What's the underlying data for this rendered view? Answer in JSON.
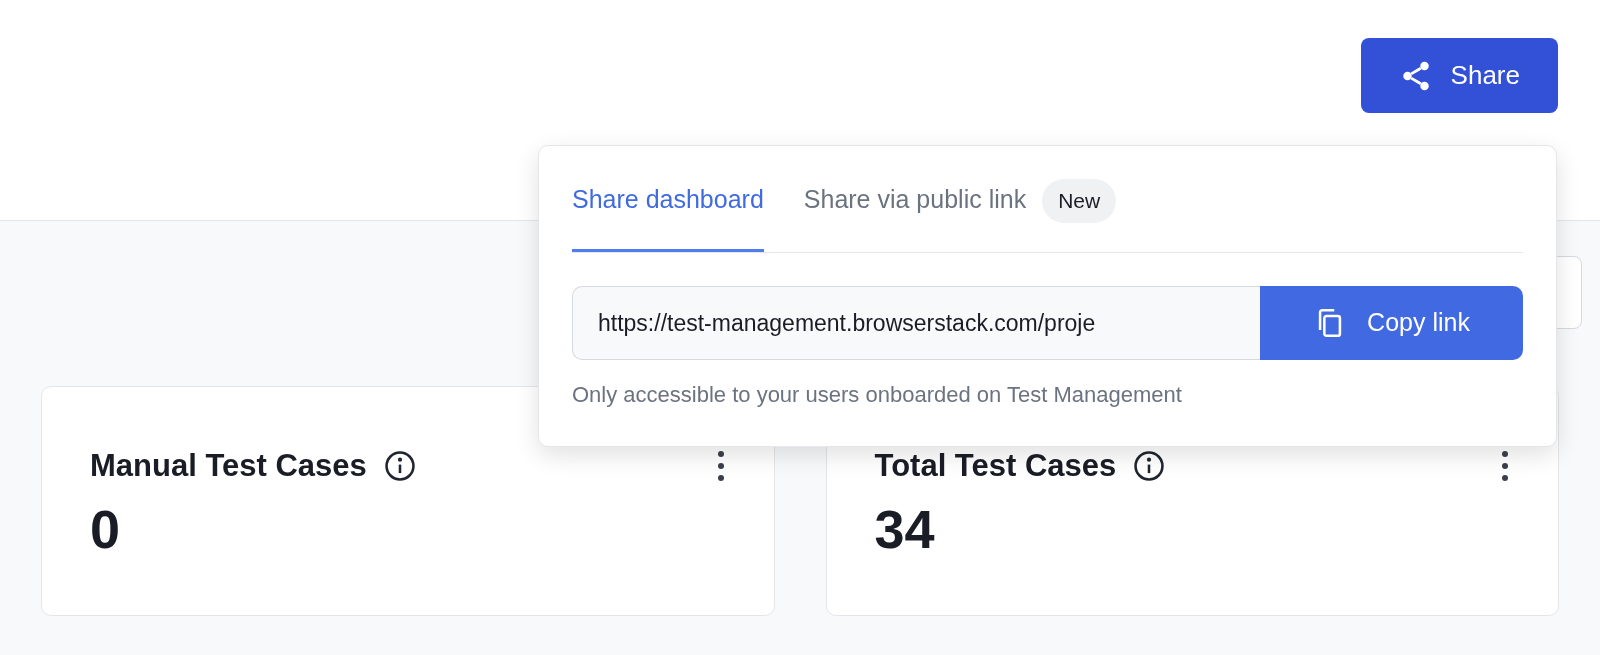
{
  "share_button": {
    "label": "Share"
  },
  "popover": {
    "tabs": [
      {
        "label": "Share dashboard",
        "selected": true
      },
      {
        "label": "Share via public link",
        "selected": false,
        "badge": "New"
      }
    ],
    "link_field": {
      "value": "https://test-management.browserstack.com/proje"
    },
    "copy_button": {
      "label": "Copy link"
    },
    "note": "Only accessible to your users onboarded on Test Management"
  },
  "cards": [
    {
      "title": "Manual Test Cases",
      "value": "0"
    },
    {
      "title": "Total Test Cases",
      "value": "34"
    }
  ]
}
